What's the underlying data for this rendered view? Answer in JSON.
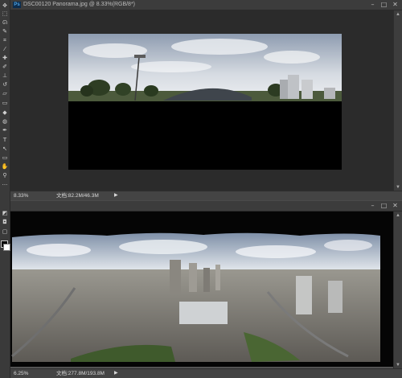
{
  "app": {
    "logo": "Ps"
  },
  "toolbar": {
    "tools": [
      {
        "name": "move-tool-icon",
        "glyph": "✥"
      },
      {
        "name": "marquee-tool-icon",
        "glyph": "⬚"
      },
      {
        "name": "lasso-tool-icon",
        "glyph": "ᘏ"
      },
      {
        "name": "quick-select-tool-icon",
        "glyph": "✎"
      },
      {
        "name": "crop-tool-icon",
        "glyph": "⌗"
      },
      {
        "name": "eyedropper-tool-icon",
        "glyph": "⁄"
      },
      {
        "name": "healing-brush-tool-icon",
        "glyph": "✚"
      },
      {
        "name": "brush-tool-icon",
        "glyph": "✐"
      },
      {
        "name": "clone-stamp-tool-icon",
        "glyph": "⊥"
      },
      {
        "name": "history-brush-tool-icon",
        "glyph": "↺"
      },
      {
        "name": "eraser-tool-icon",
        "glyph": "▱"
      },
      {
        "name": "gradient-tool-icon",
        "glyph": "▭"
      },
      {
        "name": "blur-tool-icon",
        "glyph": "◆"
      },
      {
        "name": "dodge-tool-icon",
        "glyph": "◍"
      },
      {
        "name": "pen-tool-icon",
        "glyph": "✒"
      },
      {
        "name": "type-tool-icon",
        "glyph": "T"
      },
      {
        "name": "path-select-tool-icon",
        "glyph": "↖"
      },
      {
        "name": "shape-tool-icon",
        "glyph": "▭"
      },
      {
        "name": "hand-tool-icon",
        "glyph": "✋"
      },
      {
        "name": "zoom-tool-icon",
        "glyph": "⚲"
      },
      {
        "name": "more-tools-icon",
        "glyph": "···"
      },
      {
        "name": "default-colors-icon",
        "glyph": "◩"
      },
      {
        "name": "quick-mask-icon",
        "glyph": "◘"
      },
      {
        "name": "screen-mode-icon",
        "glyph": "▢"
      }
    ]
  },
  "doc1": {
    "title": "DSC00120 Panorama.jpg @ 8.33%(RGB/8*)",
    "zoom": "8.33%",
    "doc_size": "文档:82.2M/46.3M",
    "arrow": "▶"
  },
  "doc2": {
    "zoom": "6.25%",
    "doc_size": "文档:277.8M/193.8M",
    "arrow": "▶"
  },
  "window_buttons": {
    "minimize": "–",
    "restore": "□",
    "close": "✕"
  },
  "colors": {
    "sky_top": "#8f9fb5",
    "sky_bottom": "#dfe4ea",
    "ground": "#6d6a64"
  }
}
